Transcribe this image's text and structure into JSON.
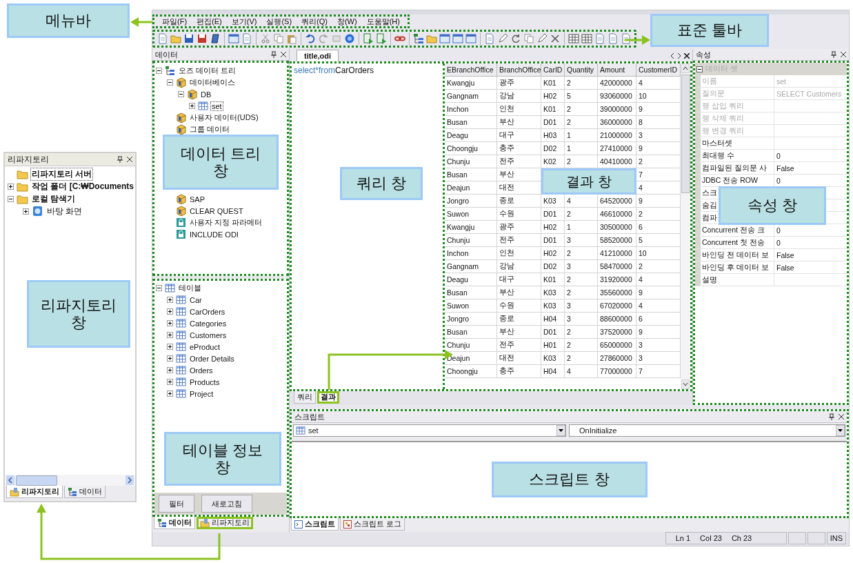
{
  "menu_bar": {
    "items": [
      "파일(F)",
      "편집(E)",
      "보기(V)",
      "실행(S)",
      "쿼리(Q)",
      "창(W)",
      "도움말(H)"
    ],
    "callout": "메뉴바"
  },
  "toolbar": {
    "callout": "표준 툴바"
  },
  "data_panel": {
    "title": "데이터",
    "tree_callout": "데이터 트리\n창",
    "tree": [
      {
        "label": "오즈 데이터 트리",
        "kind": "tree",
        "expanded": true,
        "selected": false,
        "children": [
          {
            "label": "데이터베이스",
            "kind": "package",
            "expanded": true,
            "selected": false,
            "children": [
              {
                "label": "DB",
                "kind": "package",
                "expanded": true,
                "selected": false,
                "children": [
                  {
                    "label": "set",
                    "kind": "table",
                    "expanded": false,
                    "selected": true
                  }
                ]
              }
            ]
          },
          {
            "label": "사용자 데이터(UDS)",
            "kind": "package",
            "selected": false
          },
          {
            "label": "그룹 데이터",
            "kind": "package",
            "selected": false
          },
          {
            "label": "SAP",
            "kind": "package",
            "selected": false,
            "covered_before": true
          },
          {
            "label": "CLEAR QUEST",
            "kind": "package",
            "selected": false
          },
          {
            "label": "사용자 지정 파라메터",
            "kind": "lock",
            "selected": false
          },
          {
            "label": "INCLUDE ODI",
            "kind": "lock",
            "selected": false
          }
        ]
      }
    ],
    "table_tree": [
      {
        "label": "테이블",
        "kind": "table",
        "expanded": true,
        "selected": false,
        "children": [
          {
            "label": "Car",
            "kind": "table",
            "expanded": false,
            "selected": false
          },
          {
            "label": "CarOrders",
            "kind": "table",
            "expanded": false,
            "selected": false
          },
          {
            "label": "Categories",
            "kind": "table",
            "expanded": false,
            "selected": false
          },
          {
            "label": "Customers",
            "kind": "table",
            "expanded": false,
            "selected": false
          },
          {
            "label": "eProduct",
            "kind": "table",
            "expanded": false,
            "selected": false
          },
          {
            "label": "Order Details",
            "kind": "table",
            "expanded": false,
            "selected": false
          },
          {
            "label": "Orders",
            "kind": "table",
            "expanded": false,
            "selected": false
          },
          {
            "label": "Products",
            "kind": "table",
            "expanded": false,
            "selected": false
          },
          {
            "label": "Project",
            "kind": "table",
            "expanded": false,
            "selected": false
          }
        ]
      }
    ],
    "table_callout": "테이블 정보\n창",
    "buttons": [
      "필터",
      "새로고침"
    ],
    "tabs": [
      {
        "label": "데이터",
        "selected": true,
        "highlighted": false
      },
      {
        "label": "리파지토리",
        "selected": false,
        "highlighted": true
      }
    ]
  },
  "document": {
    "tab": "title,odi",
    "query_callout": "쿼리 창",
    "query": [
      {
        "text": "select",
        "kind": "keyword"
      },
      {
        "text": "*from",
        "kind": "keyword"
      },
      {
        "text": "CarOrders",
        "kind": "identifier"
      }
    ],
    "results": {
      "callout": "결과 창",
      "columns": [
        "EBranchOffice",
        "BranchOffice",
        "CarID",
        "Quantity",
        "Amount",
        "CustomerID"
      ],
      "rows": [
        [
          "Kwangju",
          "광주",
          "K01",
          "2",
          "42000000",
          "4"
        ],
        [
          "Gangnam",
          "강남",
          "H02",
          "5",
          "93060000",
          "10"
        ],
        [
          "Inchon",
          "인천",
          "K01",
          "2",
          "39000000",
          "9"
        ],
        [
          "Busan",
          "부산",
          "D01",
          "2",
          "36000000",
          "8"
        ],
        [
          "Deagu",
          "대구",
          "H03",
          "1",
          "21000000",
          "3"
        ],
        [
          "Choongju",
          "충주",
          "D02",
          "1",
          "27410000",
          "9"
        ],
        [
          "Chunju",
          "전주",
          "K02",
          "2",
          "40410000",
          "2"
        ],
        [
          "Busan",
          "부산",
          null,
          null,
          null,
          "7"
        ],
        [
          "Deajun",
          "대전",
          null,
          null,
          null,
          "4"
        ],
        [
          "Jongro",
          "종로",
          "K03",
          "4",
          "64520000",
          "9"
        ],
        [
          "Suwon",
          "수원",
          "D01",
          "2",
          "46610000",
          "2"
        ],
        [
          "Kwangju",
          "광주",
          "H02",
          "1",
          "30500000",
          "6"
        ],
        [
          "Chunju",
          "전주",
          "D01",
          "3",
          "58520000",
          "5"
        ],
        [
          "Inchon",
          "인천",
          "H02",
          "2",
          "41210000",
          "10"
        ],
        [
          "Gangnam",
          "강남",
          "D02",
          "3",
          "58470000",
          "2"
        ],
        [
          "Deagu",
          "대구",
          "K01",
          "2",
          "31920000",
          "4"
        ],
        [
          "Busan",
          "부산",
          "K03",
          "2",
          "35560000",
          "9"
        ],
        [
          "Suwon",
          "수원",
          "K03",
          "3",
          "67020000",
          "4"
        ],
        [
          "Jongro",
          "종로",
          "H04",
          "3",
          "88600000",
          "6"
        ],
        [
          "Busan",
          "부산",
          "D01",
          "2",
          "37520000",
          "9"
        ],
        [
          "Chunju",
          "전주",
          "H01",
          "2",
          "65000000",
          "3"
        ],
        [
          "Deajun",
          "대전",
          "K03",
          "2",
          "27860000",
          "3"
        ],
        [
          "Choongju",
          "충주",
          "H04",
          "4",
          "77000000",
          "7"
        ]
      ]
    },
    "tabs": [
      {
        "label": "쿼리",
        "selected": false,
        "highlighted": false
      },
      {
        "label": "결과",
        "selected": true,
        "highlighted": true
      }
    ]
  },
  "properties": {
    "title": "속성",
    "callout": "속성 창",
    "section": {
      "label": "데이터 셋",
      "expanded": true
    },
    "rows": [
      {
        "name": "이름",
        "value": "set",
        "disabled": true
      },
      {
        "name": "질의문",
        "value": "SELECT Customers",
        "disabled": true
      },
      {
        "name": "행 삽입 쿼리",
        "disabled": true
      },
      {
        "name": "행 삭제 쿼리",
        "disabled": true
      },
      {
        "name": "행 변경 쿼리",
        "disabled": true
      },
      {
        "name": "마스터셋",
        "disabled": false
      },
      {
        "name": "최대행 수",
        "value": "0",
        "disabled": false
      },
      {
        "name": "컴파일된 질의문 사",
        "value": "False",
        "disabled": false
      },
      {
        "name": "JDBC 전송 ROW",
        "value": "0",
        "disabled": false
      },
      {
        "name": "스크",
        "disabled": false
      },
      {
        "name": "숨김",
        "disabled": false
      },
      {
        "name": "컴파",
        "disabled": false
      },
      {
        "name": "Concurrent 전송 크",
        "value": "0",
        "disabled": false
      },
      {
        "name": "Concurrent 첫 전송",
        "value": "0",
        "disabled": false
      },
      {
        "name": "바인딩 전 데이터 보",
        "value": "False",
        "disabled": false
      },
      {
        "name": "바인딩 후 데이터 보",
        "value": "False",
        "disabled": false
      },
      {
        "name": "설명",
        "disabled": false
      }
    ]
  },
  "script": {
    "title": "스크립트",
    "object_select": "set",
    "event_select": "OnInitialize",
    "callout": "스크립트 창",
    "tabs": [
      {
        "label": "스크립트",
        "selected": true
      },
      {
        "label": "스크립트 로그",
        "selected": false
      }
    ]
  },
  "status_bar": {
    "line": "Ln 1",
    "column": "Col 23",
    "char": "Ch 23",
    "mode": "INS"
  },
  "repository_panel": {
    "title": "리파지토리",
    "callout": "리파지토리\n창",
    "tree": [
      {
        "label": "리파지토리 서버",
        "kind": "folder",
        "selected": true
      },
      {
        "label": "작업 폴더 [C:₩Documents",
        "kind": "folder",
        "expanded": false,
        "selected": false
      },
      {
        "label": "로컬 탐색기",
        "kind": "folder",
        "expanded": true,
        "selected": false,
        "children": [
          {
            "label": "바탕 화면",
            "kind": "desktop",
            "expanded": false,
            "selected": false
          }
        ]
      }
    ],
    "tabs": [
      {
        "label": "리파지토리",
        "selected": true
      },
      {
        "label": "데이터",
        "selected": false
      }
    ]
  }
}
